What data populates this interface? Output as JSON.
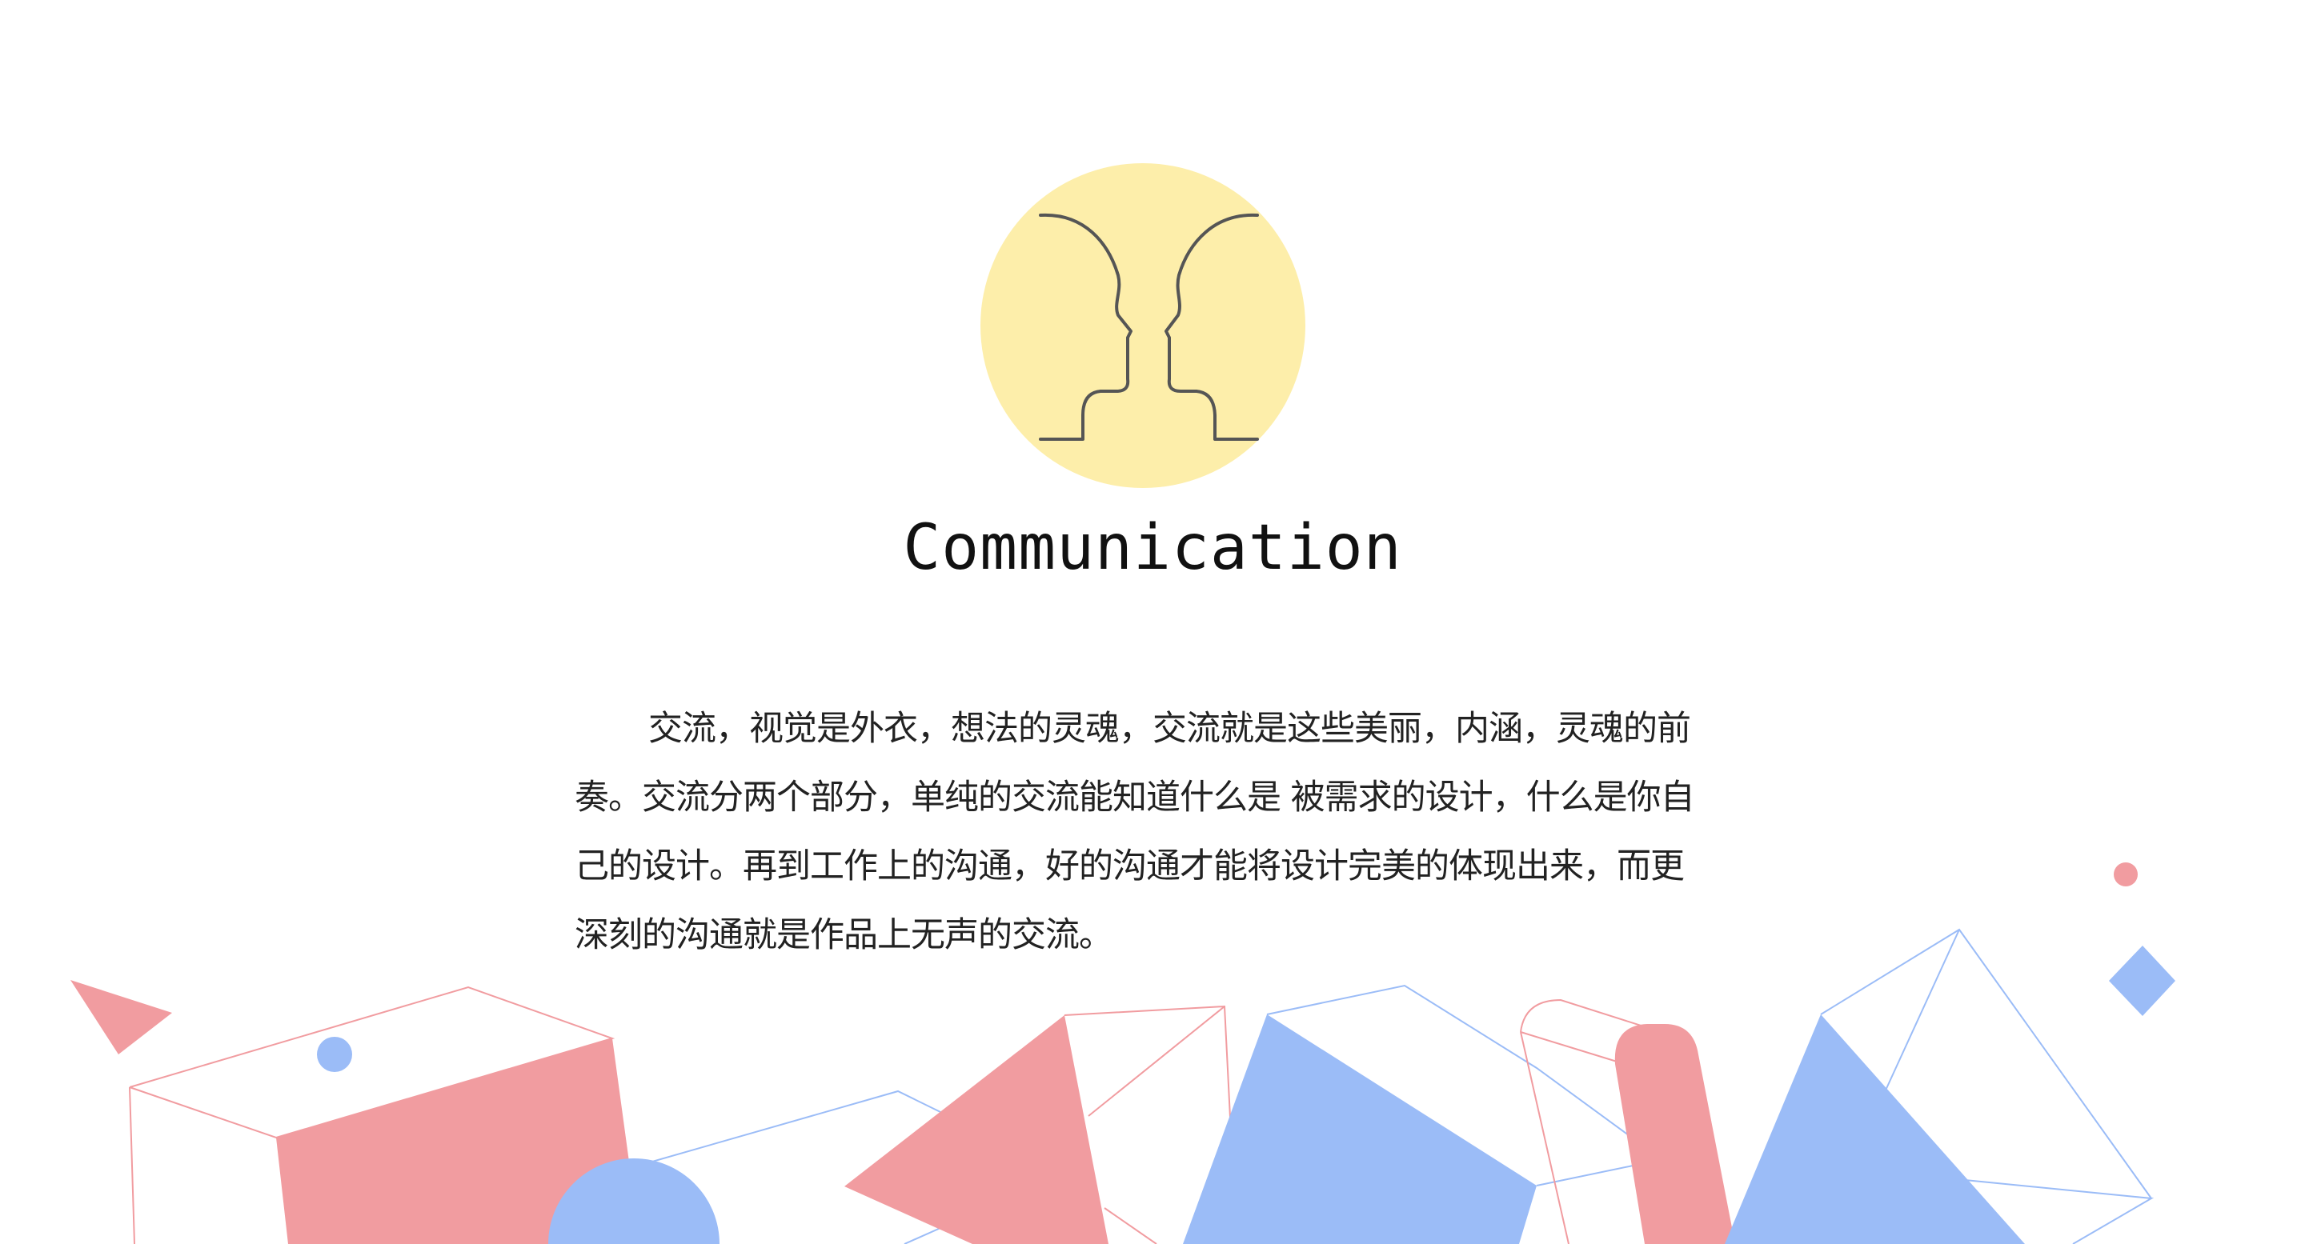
{
  "slide": {
    "title": "Communication",
    "body": "交流，视觉是外衣，想法的灵魂，交流就是这些美丽，内涵，灵魂的前奏。交流分两个部分，单纯的交流能知道什么是 被需求的设计，什么是你自己的设计。再到工作上的沟通，好的沟通才能将设计完美的体现出来，而更深刻的沟通就是作品上无声的交流。",
    "icon": "two-faces-icon"
  },
  "colors": {
    "icon_circle": "#fdeeaa",
    "icon_stroke": "#555555",
    "pink": "#f19ca0",
    "blue": "#9bbcf7"
  }
}
